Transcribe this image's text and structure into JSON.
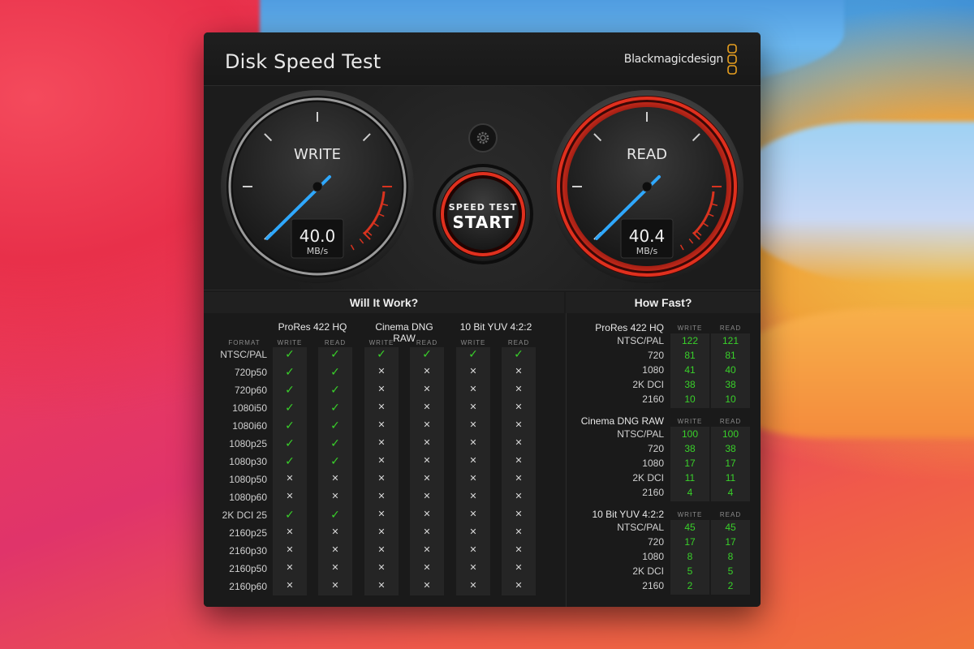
{
  "app": {
    "title": "Disk Speed Test",
    "brand": "Blackmagicdesign",
    "close_glyph": "×"
  },
  "gauges": {
    "write": {
      "label": "WRITE",
      "value": "40.0",
      "unit": "MB/s",
      "needle_color": "#2fa8ff",
      "value_num": 40.0
    },
    "read": {
      "label": "READ",
      "value": "40.4",
      "unit": "MB/s",
      "needle_color": "#2fa8ff",
      "value_num": 40.4
    },
    "start_button": {
      "line1": "SPEED TEST",
      "line2": "START"
    },
    "settings_icon": "gear-icon"
  },
  "will_it_work": {
    "title": "Will It Work?",
    "format_header": "FORMAT",
    "codecs": [
      "ProRes 422 HQ",
      "Cinema DNG RAW",
      "10 Bit YUV 4:2:2"
    ],
    "sub_headers": [
      "WRITE",
      "READ",
      "WRITE",
      "READ",
      "WRITE",
      "READ"
    ],
    "rows": [
      {
        "format": "NTSC/PAL",
        "cells": [
          "ok",
          "ok",
          "ok",
          "ok",
          "ok",
          "ok"
        ]
      },
      {
        "format": "720p50",
        "cells": [
          "ok",
          "ok",
          "no",
          "no",
          "no",
          "no"
        ]
      },
      {
        "format": "720p60",
        "cells": [
          "ok",
          "ok",
          "no",
          "no",
          "no",
          "no"
        ]
      },
      {
        "format": "1080i50",
        "cells": [
          "ok",
          "ok",
          "no",
          "no",
          "no",
          "no"
        ]
      },
      {
        "format": "1080i60",
        "cells": [
          "ok",
          "ok",
          "no",
          "no",
          "no",
          "no"
        ]
      },
      {
        "format": "1080p25",
        "cells": [
          "ok",
          "ok",
          "no",
          "no",
          "no",
          "no"
        ]
      },
      {
        "format": "1080p30",
        "cells": [
          "ok",
          "ok",
          "no",
          "no",
          "no",
          "no"
        ]
      },
      {
        "format": "1080p50",
        "cells": [
          "no",
          "no",
          "no",
          "no",
          "no",
          "no"
        ]
      },
      {
        "format": "1080p60",
        "cells": [
          "no",
          "no",
          "no",
          "no",
          "no",
          "no"
        ]
      },
      {
        "format": "2K DCI 25",
        "cells": [
          "ok",
          "ok",
          "no",
          "no",
          "no",
          "no"
        ]
      },
      {
        "format": "2160p25",
        "cells": [
          "no",
          "no",
          "no",
          "no",
          "no",
          "no"
        ]
      },
      {
        "format": "2160p30",
        "cells": [
          "no",
          "no",
          "no",
          "no",
          "no",
          "no"
        ]
      },
      {
        "format": "2160p50",
        "cells": [
          "no",
          "no",
          "no",
          "no",
          "no",
          "no"
        ]
      },
      {
        "format": "2160p60",
        "cells": [
          "no",
          "no",
          "no",
          "no",
          "no",
          "no"
        ]
      }
    ],
    "ok_glyph": "✓",
    "no_glyph": "✕"
  },
  "how_fast": {
    "title": "How Fast?",
    "write_header": "WRITE",
    "read_header": "READ",
    "groups": [
      {
        "name": "ProRes 422 HQ",
        "rows": [
          {
            "label": "NTSC/PAL",
            "write": "122",
            "read": "121"
          },
          {
            "label": "720",
            "write": "81",
            "read": "81"
          },
          {
            "label": "1080",
            "write": "41",
            "read": "40"
          },
          {
            "label": "2K DCI",
            "write": "38",
            "read": "38"
          },
          {
            "label": "2160",
            "write": "10",
            "read": "10"
          }
        ]
      },
      {
        "name": "Cinema DNG RAW",
        "rows": [
          {
            "label": "NTSC/PAL",
            "write": "100",
            "read": "100"
          },
          {
            "label": "720",
            "write": "38",
            "read": "38"
          },
          {
            "label": "1080",
            "write": "17",
            "read": "17"
          },
          {
            "label": "2K DCI",
            "write": "11",
            "read": "11"
          },
          {
            "label": "2160",
            "write": "4",
            "read": "4"
          }
        ]
      },
      {
        "name": "10 Bit YUV 4:2:2",
        "rows": [
          {
            "label": "NTSC/PAL",
            "write": "45",
            "read": "45"
          },
          {
            "label": "720",
            "write": "17",
            "read": "17"
          },
          {
            "label": "1080",
            "write": "8",
            "read": "8"
          },
          {
            "label": "2K DCI",
            "write": "5",
            "read": "5"
          },
          {
            "label": "2160",
            "write": "2",
            "read": "2"
          }
        ]
      }
    ]
  },
  "colors": {
    "accent_red": "#e0301e",
    "ok_green": "#39d12a",
    "needle_blue": "#2fa8ff"
  }
}
